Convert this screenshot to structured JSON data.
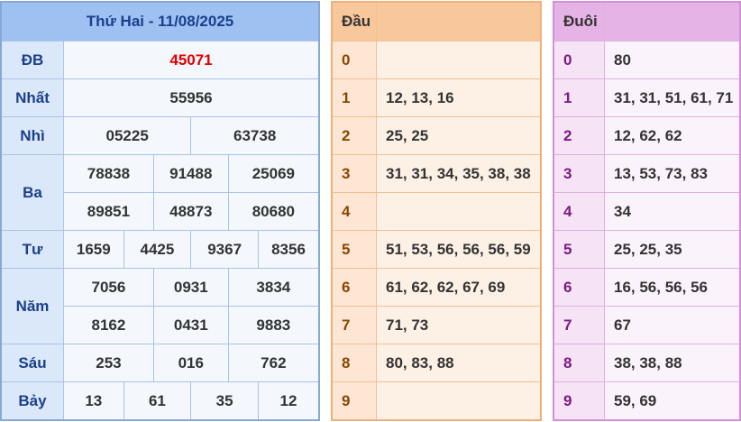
{
  "results": {
    "title": "Thứ Hai - 11/08/2025",
    "db": {
      "label": "ĐB",
      "values": [
        "45071"
      ]
    },
    "nhat": {
      "label": "Nhất",
      "values": [
        "55956"
      ]
    },
    "nhi": {
      "label": "Nhì",
      "values": [
        "05225",
        "63738"
      ]
    },
    "ba": {
      "label": "Ba",
      "values": [
        "78838",
        "91488",
        "25069",
        "89851",
        "48873",
        "80680"
      ]
    },
    "tu": {
      "label": "Tư",
      "values": [
        "1659",
        "4425",
        "9367",
        "8356"
      ]
    },
    "nam": {
      "label": "Năm",
      "values": [
        "7056",
        "0931",
        "3834",
        "8162",
        "0431",
        "9883"
      ]
    },
    "sau": {
      "label": "Sáu",
      "values": [
        "253",
        "016",
        "762"
      ]
    },
    "bay": {
      "label": "Bảy",
      "values": [
        "13",
        "61",
        "35",
        "12"
      ]
    }
  },
  "dau": {
    "header": "Đầu",
    "rows": [
      {
        "k": "0",
        "v": ""
      },
      {
        "k": "1",
        "v": "12, 13, 16"
      },
      {
        "k": "2",
        "v": "25, 25"
      },
      {
        "k": "3",
        "v": "31, 31, 34, 35, 38, 38"
      },
      {
        "k": "4",
        "v": ""
      },
      {
        "k": "5",
        "v": "51, 53, 56, 56, 56, 59"
      },
      {
        "k": "6",
        "v": "61, 62, 62, 67, 69"
      },
      {
        "k": "7",
        "v": "71, 73"
      },
      {
        "k": "8",
        "v": "80, 83, 88"
      },
      {
        "k": "9",
        "v": ""
      }
    ]
  },
  "duoi": {
    "header": "Đuôi",
    "rows": [
      {
        "k": "0",
        "v": "80"
      },
      {
        "k": "1",
        "v": "31, 31, 51, 61, 71"
      },
      {
        "k": "2",
        "v": "12, 62, 62"
      },
      {
        "k": "3",
        "v": "13, 53, 73, 83"
      },
      {
        "k": "4",
        "v": "34"
      },
      {
        "k": "5",
        "v": "25, 25, 35"
      },
      {
        "k": "6",
        "v": "16, 56, 56, 56"
      },
      {
        "k": "7",
        "v": "67"
      },
      {
        "k": "8",
        "v": "38, 38, 88"
      },
      {
        "k": "9",
        "v": "59, 69"
      }
    ]
  },
  "colors": {
    "results_header": "#9fc1f2",
    "special_prize": "#e00000",
    "dau_header": "#f8c89c",
    "duoi_header": "#e6b3e6"
  }
}
